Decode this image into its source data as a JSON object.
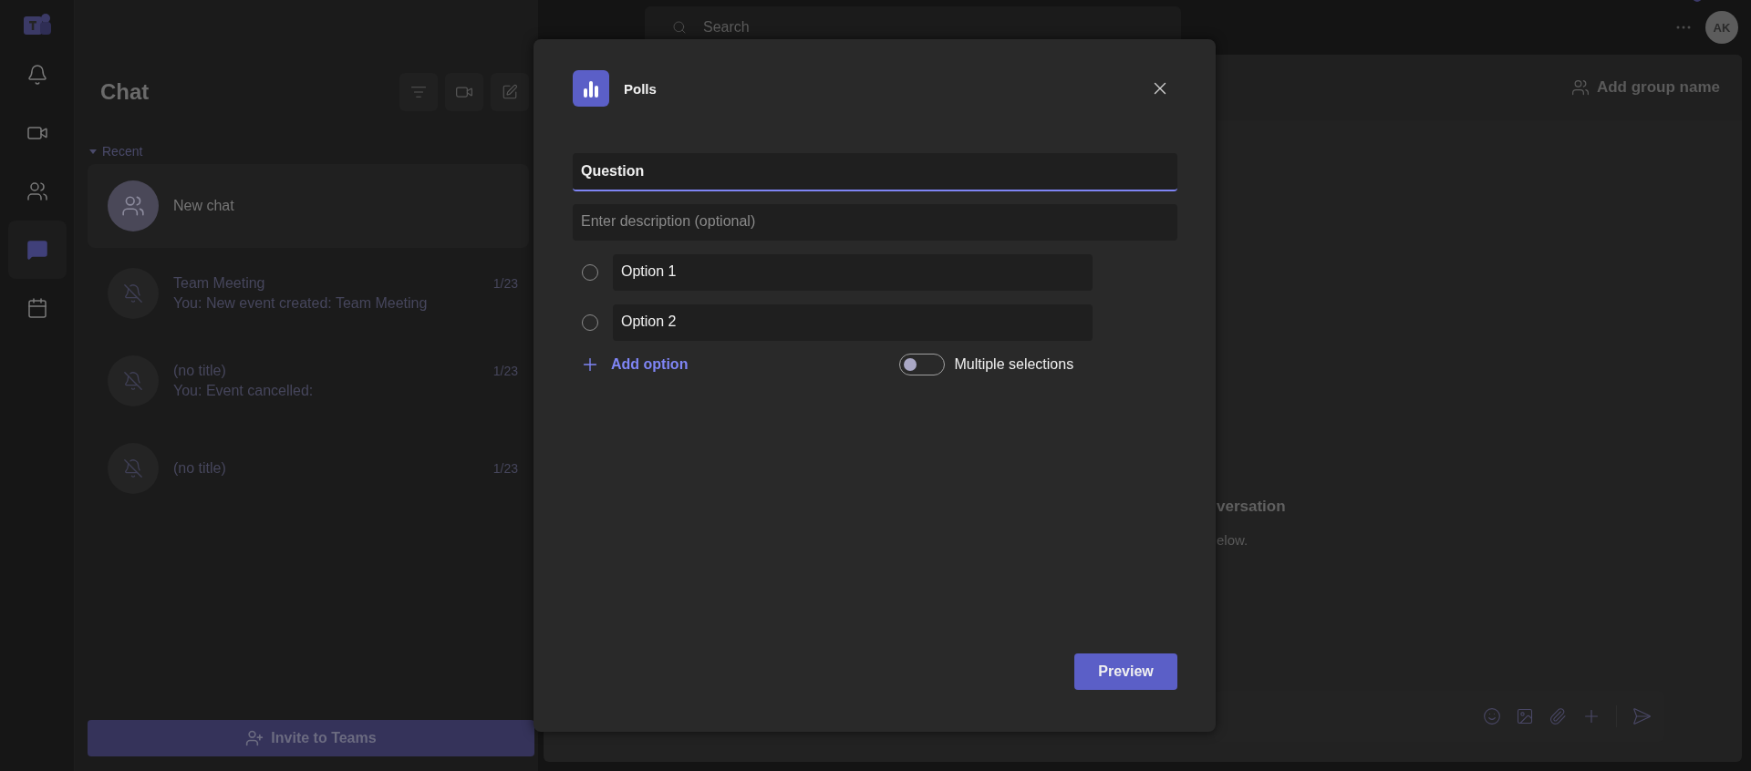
{
  "app_rail": {
    "items": [
      {
        "kind": "bell",
        "selected": false
      },
      {
        "kind": "video",
        "selected": false
      },
      {
        "kind": "people",
        "selected": false
      },
      {
        "kind": "chat",
        "selected": true
      },
      {
        "kind": "calendar",
        "selected": false
      }
    ]
  },
  "search": {
    "placeholder": "Search"
  },
  "account": {
    "initials": "AK"
  },
  "chat_list": {
    "title": "Chat",
    "section": "Recent",
    "expanded": true,
    "chats": [
      {
        "kind": "group",
        "title": "New chat",
        "selected": true
      },
      {
        "kind": "muted",
        "title": "Team Meeting",
        "preview": "You: New event created: Team Meeting",
        "date": "1/23",
        "selected": false
      },
      {
        "kind": "muted",
        "title": "(no title)",
        "preview": "You: Event cancelled:",
        "date": "1/23",
        "selected": false
      },
      {
        "kind": "muted",
        "title": "(no title)",
        "date": "1/23",
        "selected": false
      }
    ],
    "invite_button": "Invite to Teams"
  },
  "conversation": {
    "header_action": "Add group name",
    "empty_title": "versation",
    "empty_text": "elow."
  },
  "dialog": {
    "title": "Polls",
    "question": {
      "value": "Question",
      "focused": true
    },
    "description": {
      "placeholder": "Enter description (optional)"
    },
    "options": [
      {
        "value": "Option 1",
        "selected": false
      },
      {
        "value": "Option 2",
        "selected": false
      }
    ],
    "add_option": "Add option",
    "multiple_selections": {
      "label": "Multiple selections",
      "on": false
    },
    "preview_button": "Preview"
  }
}
